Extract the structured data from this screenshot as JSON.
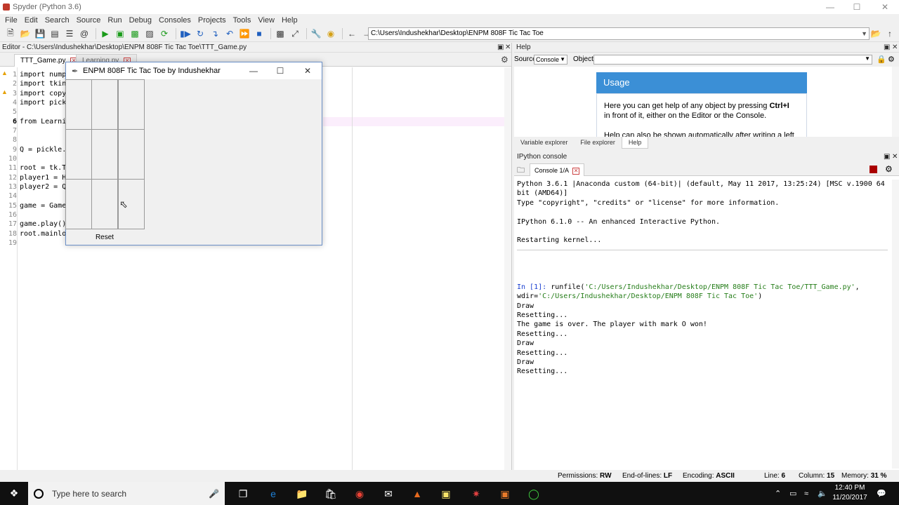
{
  "window": {
    "title": "Spyder (Python 3.6)"
  },
  "menu": [
    "File",
    "Edit",
    "Search",
    "Source",
    "Run",
    "Debug",
    "Consoles",
    "Projects",
    "Tools",
    "View",
    "Help"
  ],
  "toolbar": {
    "path": "C:\\Users\\Indushekhar\\Desktop\\ENPM 808F Tic Tac Toe"
  },
  "editor": {
    "header": "Editor - C:\\Users\\Indushekhar\\Desktop\\ENPM 808F Tic Tac Toe\\TTT_Game.py",
    "tabs": [
      {
        "label": "TTT_Game.py"
      },
      {
        "label": "Learning.py"
      }
    ],
    "lines": [
      {
        "num": "1",
        "text": "import nump"
      },
      {
        "num": "2",
        "text": "import tkin"
      },
      {
        "num": "3",
        "text": "import copy"
      },
      {
        "num": "4",
        "text": "import pick"
      },
      {
        "num": "5",
        "text": ""
      },
      {
        "num": "6",
        "text": "from Learni"
      },
      {
        "num": "7",
        "text": ""
      },
      {
        "num": "8",
        "text": ""
      },
      {
        "num": "9",
        "text": "Q = pickle."
      },
      {
        "num": "10",
        "text": ""
      },
      {
        "num": "11",
        "text": "root = tk.T"
      },
      {
        "num": "12",
        "text": "player1 = H"
      },
      {
        "num": "13",
        "text": "player2 = Q"
      },
      {
        "num": "14",
        "text": ""
      },
      {
        "num": "15",
        "text": "game = Game"
      },
      {
        "num": "16",
        "text": ""
      },
      {
        "num": "17",
        "text": "game.play()"
      },
      {
        "num": "18",
        "text": "root.mainlo"
      },
      {
        "num": "19",
        "text": ""
      }
    ]
  },
  "tk_window": {
    "title": "ENPM 808F Tic Tac Toe by Indushekhar",
    "reset_label": "Reset"
  },
  "help": {
    "header": "Help",
    "source_label": "Source",
    "source_value": "Console",
    "object_label": "Object",
    "usage_title": "Usage",
    "usage_text_1": "Here you can get help of any object by pressing",
    "usage_shortcut": "Ctrl+I",
    "usage_text_2": "in front of it, either on the Editor or the Console.",
    "usage_text_3": "Help can also be shown automatically after writing a left",
    "tabs": [
      "Variable explorer",
      "File explorer",
      "Help"
    ]
  },
  "console": {
    "header": "IPython console",
    "tab_label": "Console 1/A",
    "lines": [
      "Python 3.6.1 |Anaconda custom (64-bit)| (default, May 11 2017, 13:25:24) [MSC v.1900 64",
      "bit (AMD64)]",
      "Type \"copyright\", \"credits\" or \"license\" for more information.",
      "",
      "IPython 6.1.0 -- An enhanced Interactive Python.",
      "",
      "Restarting kernel..."
    ],
    "run_prompt": "In [1]:",
    "run_cmd": "runfile(",
    "run_arg1": "'C:/Users/Indushekhar/Desktop/ENPM 808F Tic Tac Toe/TTT_Game.py'",
    "run_comma": ",",
    "run_wdir_key": "wdir=",
    "run_arg2": "'C:/Users/Indushekhar/Desktop/ENPM 808F Tic Tac Toe'",
    "run_close": ")",
    "output": [
      "Draw",
      "Resetting...",
      "The game is over. The player with mark O won!",
      "Resetting...",
      "Draw",
      "Resetting...",
      "Draw",
      "Resetting..."
    ]
  },
  "status": {
    "permissions_label": "Permissions:",
    "permissions_value": "RW",
    "eol_label": "End-of-lines:",
    "eol_value": "LF",
    "encoding_label": "Encoding:",
    "encoding_value": "ASCII",
    "line_label": "Line:",
    "line_value": "6",
    "column_label": "Column:",
    "column_value": "15",
    "memory_label": "Memory:",
    "memory_value": "31 %"
  },
  "taskbar": {
    "search_placeholder": "Type here to search",
    "time": "12:40 PM",
    "date": "11/20/2017"
  }
}
